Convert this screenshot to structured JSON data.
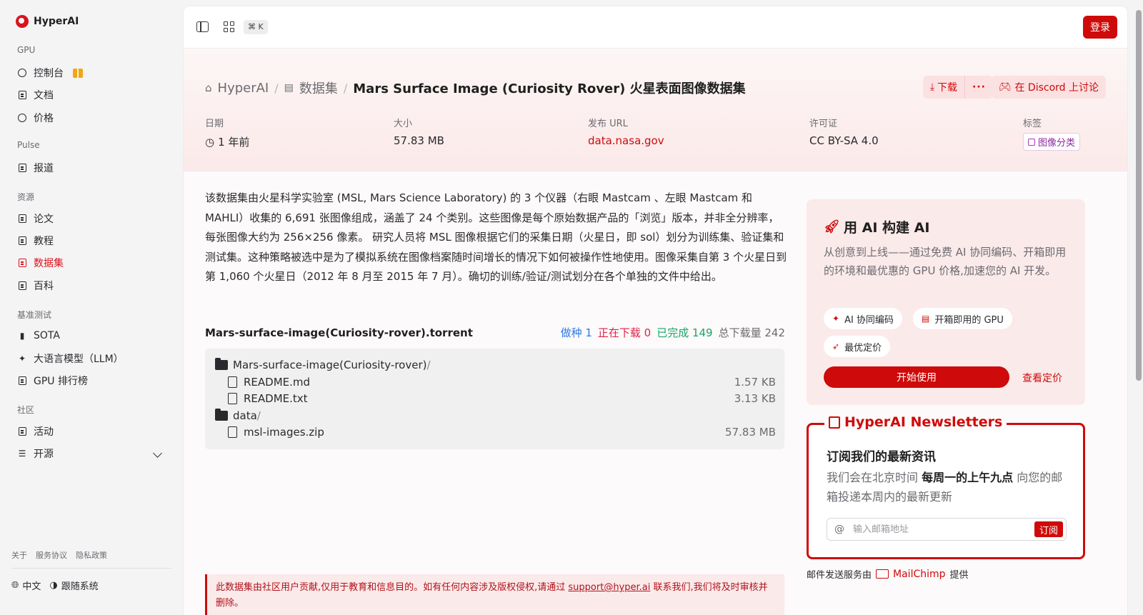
{
  "app": {
    "name": "HyperAI",
    "brand_color": "#cf0a0a"
  },
  "sidebar": {
    "sections": [
      {
        "title": "GPU"
      },
      {
        "title": "Pulse"
      },
      {
        "title": "资源"
      },
      {
        "title": "基准测试"
      },
      {
        "title": "社区"
      }
    ],
    "items": [
      {
        "label": "控制台",
        "icon": "dashboard-icon"
      },
      {
        "label": "文档",
        "icon": "doc-icon"
      },
      {
        "label": "价格",
        "icon": "price-icon"
      },
      {
        "label": "报道",
        "icon": "news-icon"
      },
      {
        "label": "论文",
        "icon": "paper-icon"
      },
      {
        "label": "教程",
        "icon": "tutorial-icon"
      },
      {
        "label": "数据集",
        "icon": "database-icon",
        "active": true
      },
      {
        "label": "百科",
        "icon": "wiki-icon"
      },
      {
        "label": "SOTA",
        "icon": "chart-icon"
      },
      {
        "label": "大语言模型（LLM）",
        "icon": "sparkle-icon"
      },
      {
        "label": "GPU 排行榜",
        "icon": "chip-icon"
      },
      {
        "label": "活动",
        "icon": "calendar-icon"
      },
      {
        "label": "开源",
        "icon": "list-icon"
      }
    ],
    "footer_links": [
      "关于",
      "服务协议",
      "隐私政策"
    ],
    "language": "中文",
    "theme": "跟随系统"
  },
  "topbar": {
    "shortcut": "⌘ K",
    "login_label": "登录"
  },
  "breadcrumb": {
    "home": "HyperAI",
    "section": "数据集",
    "title": "Mars Surface Image (Curiosity Rover) 火星表面图像数据集"
  },
  "actions": {
    "download_label": "下载",
    "more_label": "···",
    "discord_label": "在 Discord 上讨论"
  },
  "meta": {
    "date_label": "日期",
    "date_value": "1 年前",
    "size_label": "大小",
    "size_value": "57.83 MB",
    "url_label": "发布 URL",
    "url_value": "data.nasa.gov",
    "license_label": "许可证",
    "license_value": "CC BY-SA 4.0",
    "tags_label": "标签",
    "tag_value": "图像分类"
  },
  "description": "该数据集由火星科学实验室 (MSL, Mars Science Laboratory) 的 3 个仪器（右眼 Mastcam 、左眼 Mastcam 和 MAHLI）收集的 6,691 张图像组成，涵盖了 24 个类别。这些图像是每个原始数据产品的「浏览」版本，并非全分辨率，每张图像大约为 256×256 像素。 研究人员将 MSL 图像根据它们的采集日期（火星日，即 sol）划分为训练集、验证集和测试集。这种策略被选中是为了模拟系统在图像档案随时间增长的情况下如何被操作性地使用。图像采集自第 3 个火星日到第 1,060 个火星日（2012 年 8 月至 2015 年 7 月）。确切的训练/验证/测试划分在各个单独的文件中给出。",
  "torrent": {
    "name": "Mars-surface-image(Curiosity-rover).torrent",
    "seeds": "做种 1",
    "downloading": "正在下载 0",
    "completed": "已完成 149",
    "total": "总下载量 242",
    "files": [
      {
        "name": "Mars-surface-image(Curiosity-rover)",
        "type": "folder",
        "size": ""
      },
      {
        "name": "README.md",
        "type": "file",
        "size": "1.57 KB"
      },
      {
        "name": "README.txt",
        "type": "file",
        "size": "3.13 KB"
      },
      {
        "name": "data",
        "type": "folder",
        "size": ""
      },
      {
        "name": "msl-images.zip",
        "type": "file",
        "size": "57.83 MB"
      }
    ]
  },
  "notice": {
    "text_before": "此数据集由社区用户贡献,仅用于教育和信息目的。如有任何内容涉及版权侵权,请通过 ",
    "email": "support@hyper.ai",
    "text_after": " 联系我们,我们将及时审核并删除。"
  },
  "ai_card": {
    "title": "用 AI 构建 AI",
    "description": "从创意到上线——通过免费 AI 协同编码、开箱即用的环境和最优惠的 GPU 价格,加速您的 AI 开发。",
    "pills": [
      "AI 协同编码",
      "开箱即用的 GPU",
      "最优定价"
    ],
    "start_label": "开始使用",
    "pricing_label": "查看定价"
  },
  "newsletter": {
    "legend": "HyperAI Newsletters",
    "heading": "订阅我们的最新资讯",
    "text_before": "我们会在北京时间 ",
    "text_bold": "每周一的上午九点",
    "text_after": " 向您的邮箱投递本周内的最新更新",
    "email_placeholder": "输入邮箱地址",
    "subscribe_label": "订阅",
    "provider_before": "邮件发送服务由",
    "provider_name": "MailChimp",
    "provider_after": "提供"
  }
}
